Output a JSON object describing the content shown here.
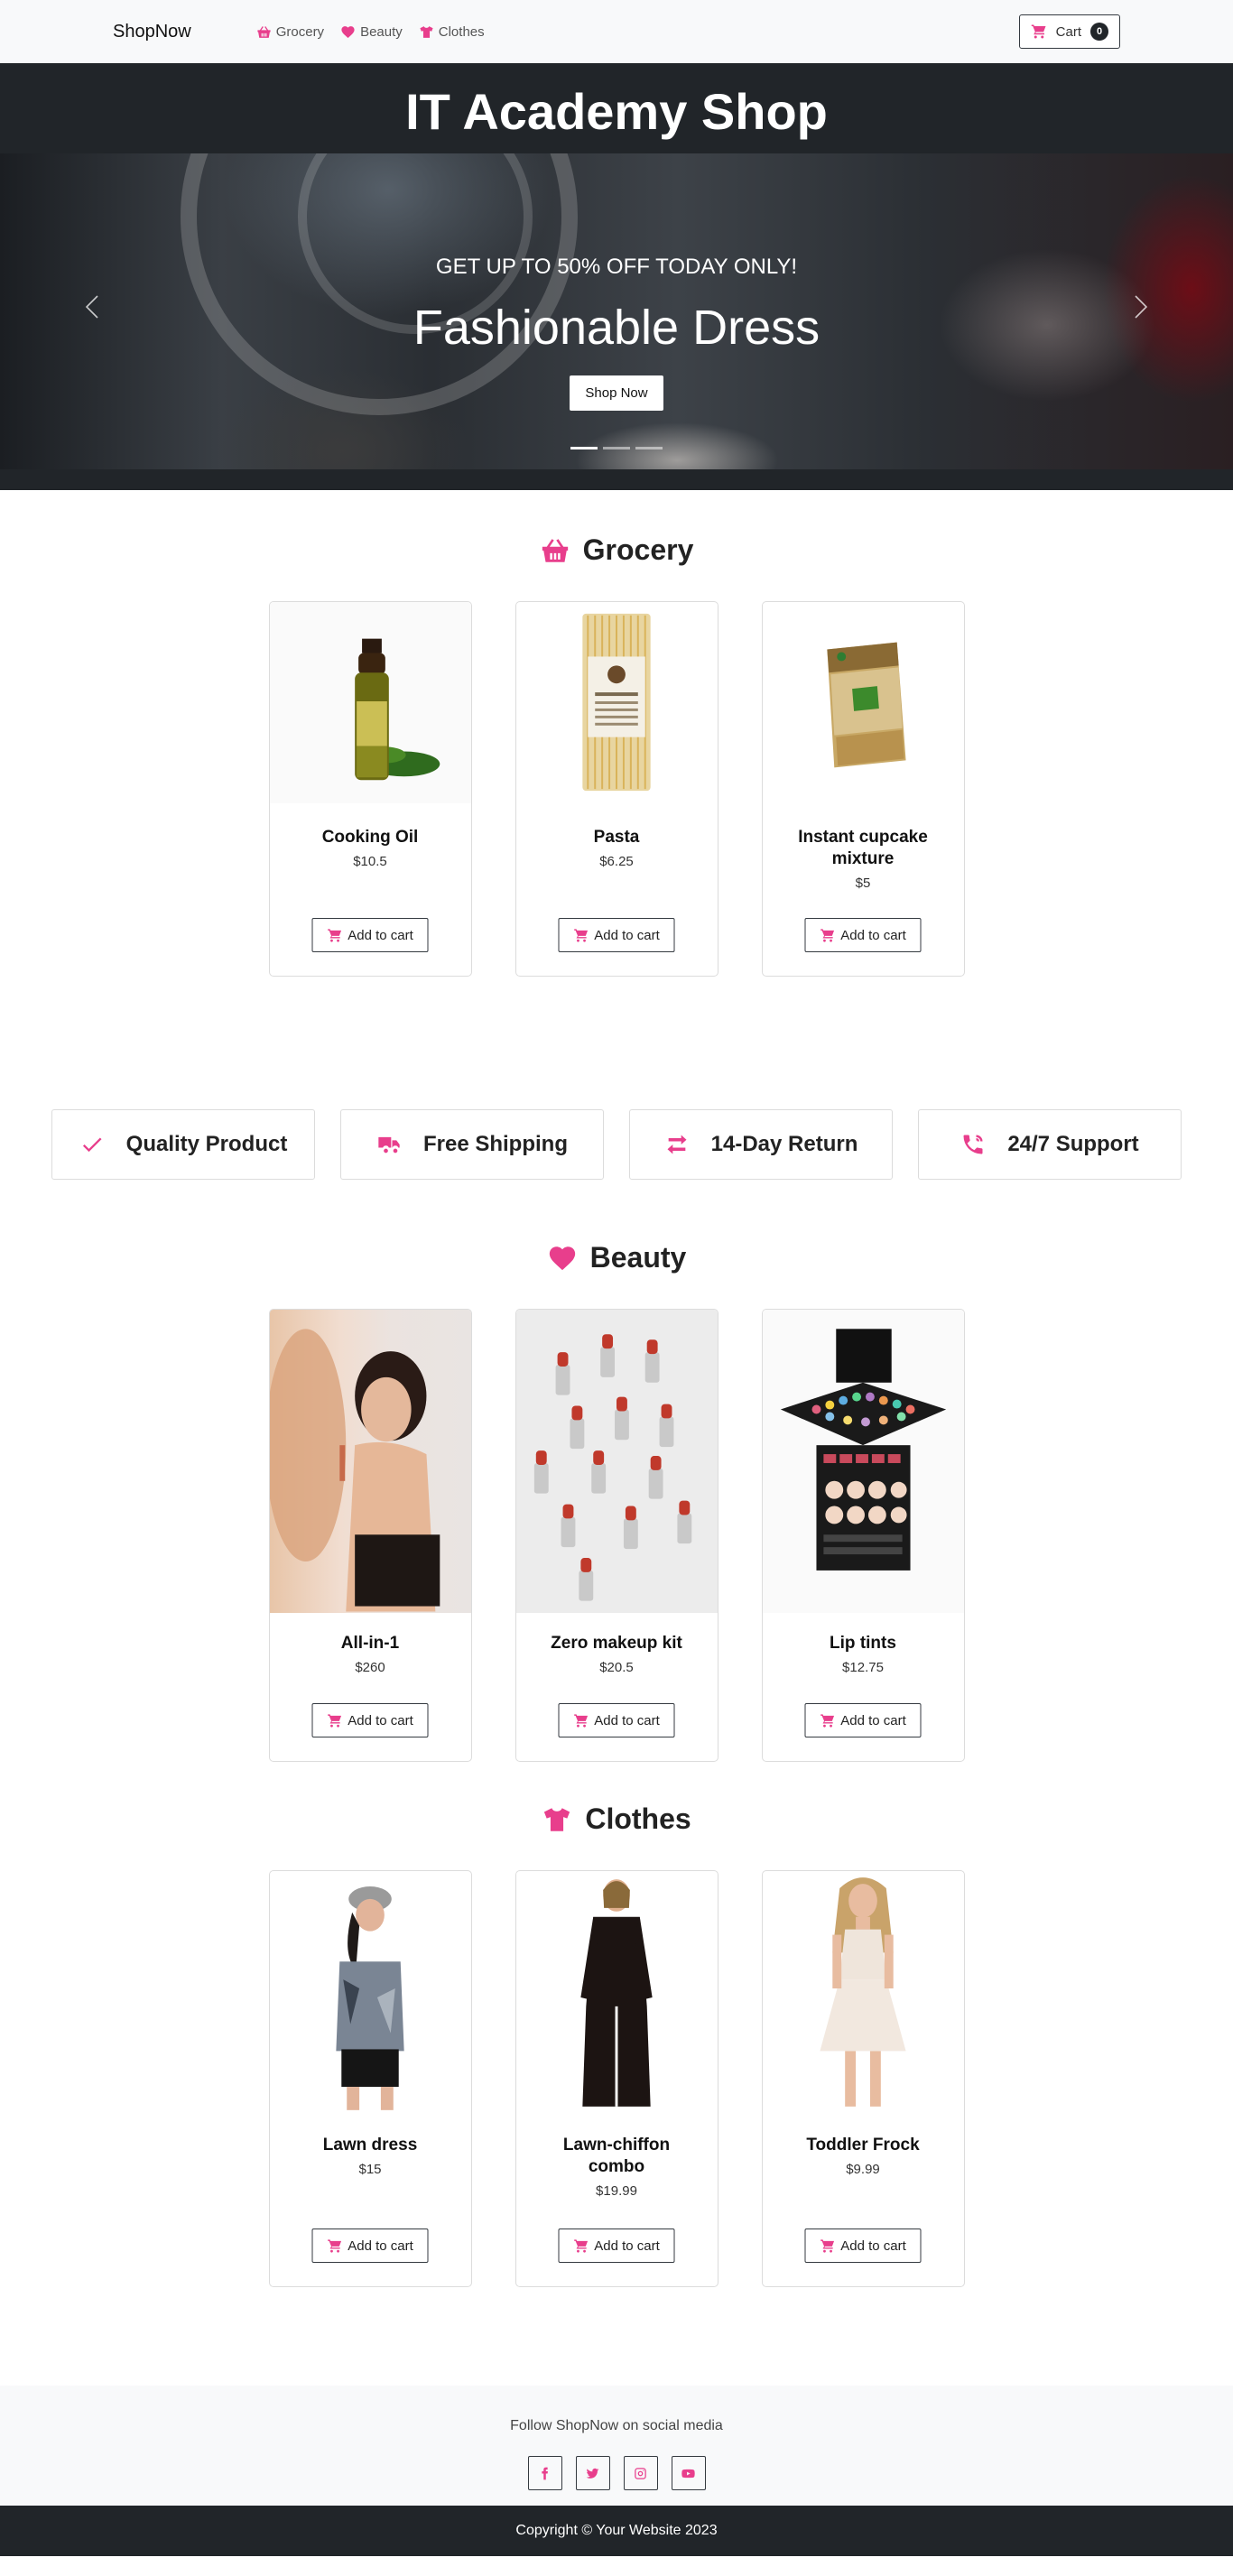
{
  "navbar": {
    "brand": "ShopNow",
    "links": [
      {
        "label": "Grocery",
        "icon": "basket-icon"
      },
      {
        "label": "Beauty",
        "icon": "heart-icon"
      },
      {
        "label": "Clothes",
        "icon": "tshirt-icon"
      }
    ],
    "cart_label": "Cart",
    "cart_count": "0"
  },
  "hero": {
    "title": "IT Academy Shop",
    "slide": {
      "subtitle": "GET UP TO 50% OFF TODAY ONLY!",
      "heading": "Fashionable Dress",
      "button": "Shop Now"
    },
    "indicator_count": 3,
    "active_indicator": 0
  },
  "grocery": {
    "heading": "Grocery",
    "products": [
      {
        "name": "Cooking Oil",
        "price": "$10.5",
        "button": "Add to cart"
      },
      {
        "name": "Pasta",
        "price": "$6.25",
        "button": "Add to cart"
      },
      {
        "name": "Instant cupcake mixture",
        "price": "$5",
        "button": "Add to cart"
      }
    ]
  },
  "features": [
    {
      "label": "Quality Product",
      "icon": "check-icon"
    },
    {
      "label": "Free Shipping",
      "icon": "truck-icon"
    },
    {
      "label": "14-Day Return",
      "icon": "exchange-icon"
    },
    {
      "label": "24/7 Support",
      "icon": "phone-icon"
    }
  ],
  "beauty": {
    "heading": "Beauty",
    "products": [
      {
        "name": "All-in-1",
        "price": "$260",
        "button": "Add to cart"
      },
      {
        "name": "Zero makeup kit",
        "price": "$20.5",
        "button": "Add to cart"
      },
      {
        "name": "Lip tints",
        "price": "$12.75",
        "button": "Add to cart"
      }
    ]
  },
  "clothes": {
    "heading": "Clothes",
    "products": [
      {
        "name": "Lawn dress",
        "price": "$15",
        "button": "Add to cart"
      },
      {
        "name": "Lawn-chiffon combo",
        "price": "$19.99",
        "button": "Add to cart"
      },
      {
        "name": "Toddler Frock",
        "price": "$9.99",
        "button": "Add to cart"
      }
    ]
  },
  "footer": {
    "social_title": "Follow ShopNow on social media",
    "social": [
      "facebook-icon",
      "twitter-icon",
      "instagram-icon",
      "youtube-icon"
    ],
    "copyright": "Copyright © Your Website 2023"
  },
  "colors": {
    "accent": "#e83e8c",
    "dark": "#212529",
    "light": "#f8f9fa"
  }
}
